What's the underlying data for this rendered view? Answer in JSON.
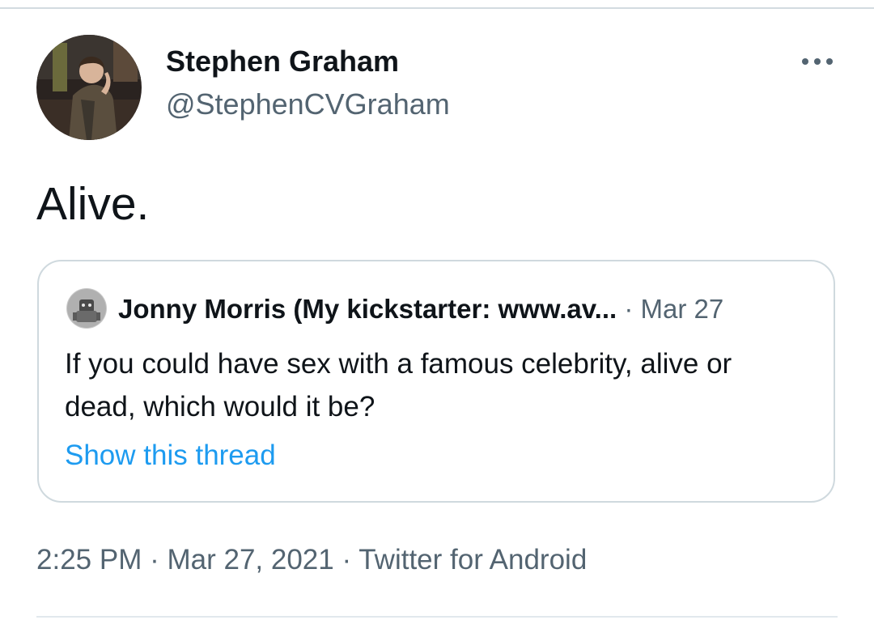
{
  "tweet": {
    "author": {
      "name": "Stephen Graham",
      "handle": "@StephenCVGraham"
    },
    "text": "Alive.",
    "more_icon": "more-horizontal-icon",
    "quoted": {
      "author_name": "Jonny Morris (My kickstarter: www.av...",
      "separator": "·",
      "date": "Mar 27",
      "text": "If you could have sex with a famous celebrity, alive or dead, which would it be?",
      "show_thread_label": "Show this thread"
    },
    "meta": {
      "time": "2:25 PM",
      "sep1": "·",
      "date": "Mar 27, 2021",
      "sep2": "·",
      "source": "Twitter for Android"
    }
  },
  "colors": {
    "primary_text": "#0f1419",
    "secondary_text": "#536471",
    "link": "#1d9bf0",
    "border": "#cfd9de"
  }
}
